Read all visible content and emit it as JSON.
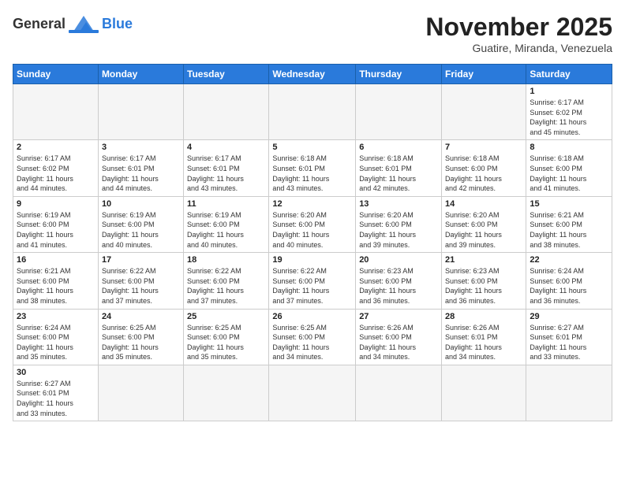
{
  "header": {
    "logo_general": "General",
    "logo_blue": "Blue",
    "month_title": "November 2025",
    "location": "Guatire, Miranda, Venezuela"
  },
  "days_of_week": [
    "Sunday",
    "Monday",
    "Tuesday",
    "Wednesday",
    "Thursday",
    "Friday",
    "Saturday"
  ],
  "weeks": [
    [
      {
        "day": "",
        "info": ""
      },
      {
        "day": "",
        "info": ""
      },
      {
        "day": "",
        "info": ""
      },
      {
        "day": "",
        "info": ""
      },
      {
        "day": "",
        "info": ""
      },
      {
        "day": "",
        "info": ""
      },
      {
        "day": "1",
        "info": "Sunrise: 6:17 AM\nSunset: 6:02 PM\nDaylight: 11 hours\nand 45 minutes."
      }
    ],
    [
      {
        "day": "2",
        "info": "Sunrise: 6:17 AM\nSunset: 6:02 PM\nDaylight: 11 hours\nand 44 minutes."
      },
      {
        "day": "3",
        "info": "Sunrise: 6:17 AM\nSunset: 6:01 PM\nDaylight: 11 hours\nand 44 minutes."
      },
      {
        "day": "4",
        "info": "Sunrise: 6:17 AM\nSunset: 6:01 PM\nDaylight: 11 hours\nand 43 minutes."
      },
      {
        "day": "5",
        "info": "Sunrise: 6:18 AM\nSunset: 6:01 PM\nDaylight: 11 hours\nand 43 minutes."
      },
      {
        "day": "6",
        "info": "Sunrise: 6:18 AM\nSunset: 6:01 PM\nDaylight: 11 hours\nand 42 minutes."
      },
      {
        "day": "7",
        "info": "Sunrise: 6:18 AM\nSunset: 6:00 PM\nDaylight: 11 hours\nand 42 minutes."
      },
      {
        "day": "8",
        "info": "Sunrise: 6:18 AM\nSunset: 6:00 PM\nDaylight: 11 hours\nand 41 minutes."
      }
    ],
    [
      {
        "day": "9",
        "info": "Sunrise: 6:19 AM\nSunset: 6:00 PM\nDaylight: 11 hours\nand 41 minutes."
      },
      {
        "day": "10",
        "info": "Sunrise: 6:19 AM\nSunset: 6:00 PM\nDaylight: 11 hours\nand 40 minutes."
      },
      {
        "day": "11",
        "info": "Sunrise: 6:19 AM\nSunset: 6:00 PM\nDaylight: 11 hours\nand 40 minutes."
      },
      {
        "day": "12",
        "info": "Sunrise: 6:20 AM\nSunset: 6:00 PM\nDaylight: 11 hours\nand 40 minutes."
      },
      {
        "day": "13",
        "info": "Sunrise: 6:20 AM\nSunset: 6:00 PM\nDaylight: 11 hours\nand 39 minutes."
      },
      {
        "day": "14",
        "info": "Sunrise: 6:20 AM\nSunset: 6:00 PM\nDaylight: 11 hours\nand 39 minutes."
      },
      {
        "day": "15",
        "info": "Sunrise: 6:21 AM\nSunset: 6:00 PM\nDaylight: 11 hours\nand 38 minutes."
      }
    ],
    [
      {
        "day": "16",
        "info": "Sunrise: 6:21 AM\nSunset: 6:00 PM\nDaylight: 11 hours\nand 38 minutes."
      },
      {
        "day": "17",
        "info": "Sunrise: 6:22 AM\nSunset: 6:00 PM\nDaylight: 11 hours\nand 37 minutes."
      },
      {
        "day": "18",
        "info": "Sunrise: 6:22 AM\nSunset: 6:00 PM\nDaylight: 11 hours\nand 37 minutes."
      },
      {
        "day": "19",
        "info": "Sunrise: 6:22 AM\nSunset: 6:00 PM\nDaylight: 11 hours\nand 37 minutes."
      },
      {
        "day": "20",
        "info": "Sunrise: 6:23 AM\nSunset: 6:00 PM\nDaylight: 11 hours\nand 36 minutes."
      },
      {
        "day": "21",
        "info": "Sunrise: 6:23 AM\nSunset: 6:00 PM\nDaylight: 11 hours\nand 36 minutes."
      },
      {
        "day": "22",
        "info": "Sunrise: 6:24 AM\nSunset: 6:00 PM\nDaylight: 11 hours\nand 36 minutes."
      }
    ],
    [
      {
        "day": "23",
        "info": "Sunrise: 6:24 AM\nSunset: 6:00 PM\nDaylight: 11 hours\nand 35 minutes."
      },
      {
        "day": "24",
        "info": "Sunrise: 6:25 AM\nSunset: 6:00 PM\nDaylight: 11 hours\nand 35 minutes."
      },
      {
        "day": "25",
        "info": "Sunrise: 6:25 AM\nSunset: 6:00 PM\nDaylight: 11 hours\nand 35 minutes."
      },
      {
        "day": "26",
        "info": "Sunrise: 6:25 AM\nSunset: 6:00 PM\nDaylight: 11 hours\nand 34 minutes."
      },
      {
        "day": "27",
        "info": "Sunrise: 6:26 AM\nSunset: 6:00 PM\nDaylight: 11 hours\nand 34 minutes."
      },
      {
        "day": "28",
        "info": "Sunrise: 6:26 AM\nSunset: 6:01 PM\nDaylight: 11 hours\nand 34 minutes."
      },
      {
        "day": "29",
        "info": "Sunrise: 6:27 AM\nSunset: 6:01 PM\nDaylight: 11 hours\nand 33 minutes."
      }
    ],
    [
      {
        "day": "30",
        "info": "Sunrise: 6:27 AM\nSunset: 6:01 PM\nDaylight: 11 hours\nand 33 minutes."
      },
      {
        "day": "",
        "info": ""
      },
      {
        "day": "",
        "info": ""
      },
      {
        "day": "",
        "info": ""
      },
      {
        "day": "",
        "info": ""
      },
      {
        "day": "",
        "info": ""
      },
      {
        "day": "",
        "info": ""
      }
    ]
  ]
}
